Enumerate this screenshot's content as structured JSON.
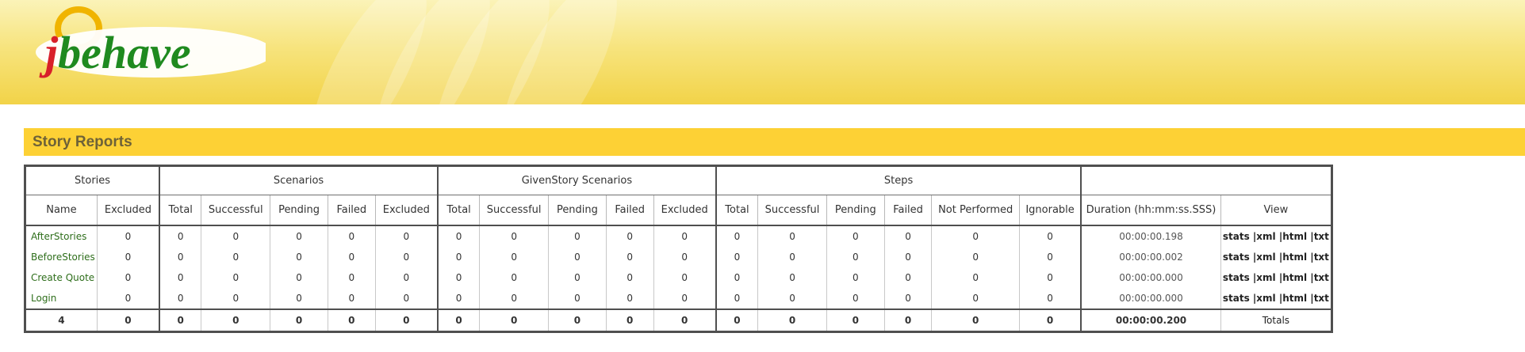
{
  "logo": {
    "text": "jbehave"
  },
  "page_title": "Story Reports",
  "groups": {
    "stories": "Stories",
    "scenarios": "Scenarios",
    "given_scenarios": "GivenStory Scenarios",
    "steps": "Steps"
  },
  "columns": {
    "name": "Name",
    "excluded": "Excluded",
    "sc_total": "Total",
    "sc_successful": "Successful",
    "sc_pending": "Pending",
    "sc_failed": "Failed",
    "sc_excluded": "Excluded",
    "gs_total": "Total",
    "gs_successful": "Successful",
    "gs_pending": "Pending",
    "gs_failed": "Failed",
    "gs_excluded": "Excluded",
    "st_total": "Total",
    "st_successful": "Successful",
    "st_pending": "Pending",
    "st_failed": "Failed",
    "st_not_performed": "Not Performed",
    "st_ignorable": "Ignorable",
    "duration": "Duration (hh:mm:ss.SSS)",
    "view": "View"
  },
  "view_links": [
    "stats",
    "xml",
    "html",
    "txt"
  ],
  "rows": [
    {
      "name": "AfterStories",
      "values": [
        "0",
        "0",
        "0",
        "0",
        "0",
        "0",
        "0",
        "0",
        "0",
        "0",
        "0",
        "0",
        "0",
        "0",
        "0",
        "0",
        "0"
      ],
      "duration": "00:00:00.198"
    },
    {
      "name": "BeforeStories",
      "values": [
        "0",
        "0",
        "0",
        "0",
        "0",
        "0",
        "0",
        "0",
        "0",
        "0",
        "0",
        "0",
        "0",
        "0",
        "0",
        "0",
        "0"
      ],
      "duration": "00:00:00.002"
    },
    {
      "name": "Create Quote",
      "values": [
        "0",
        "0",
        "0",
        "0",
        "0",
        "0",
        "0",
        "0",
        "0",
        "0",
        "0",
        "0",
        "0",
        "0",
        "0",
        "0",
        "0"
      ],
      "duration": "00:00:00.000"
    },
    {
      "name": "Login",
      "values": [
        "0",
        "0",
        "0",
        "0",
        "0",
        "0",
        "0",
        "0",
        "0",
        "0",
        "0",
        "0",
        "0",
        "0",
        "0",
        "0",
        "0"
      ],
      "duration": "00:00:00.000"
    }
  ],
  "totals": {
    "count": "4",
    "values": [
      "0",
      "0",
      "0",
      "0",
      "0",
      "0",
      "0",
      "0",
      "0",
      "0",
      "0",
      "0",
      "0",
      "0",
      "0",
      "0",
      "0"
    ],
    "duration": "00:00:00.200",
    "label": "Totals"
  },
  "colors": {
    "banner": "#f4d94f",
    "title_bar": "#fdd135",
    "title_text": "#6e6238",
    "story_link": "#2e6e1b"
  }
}
